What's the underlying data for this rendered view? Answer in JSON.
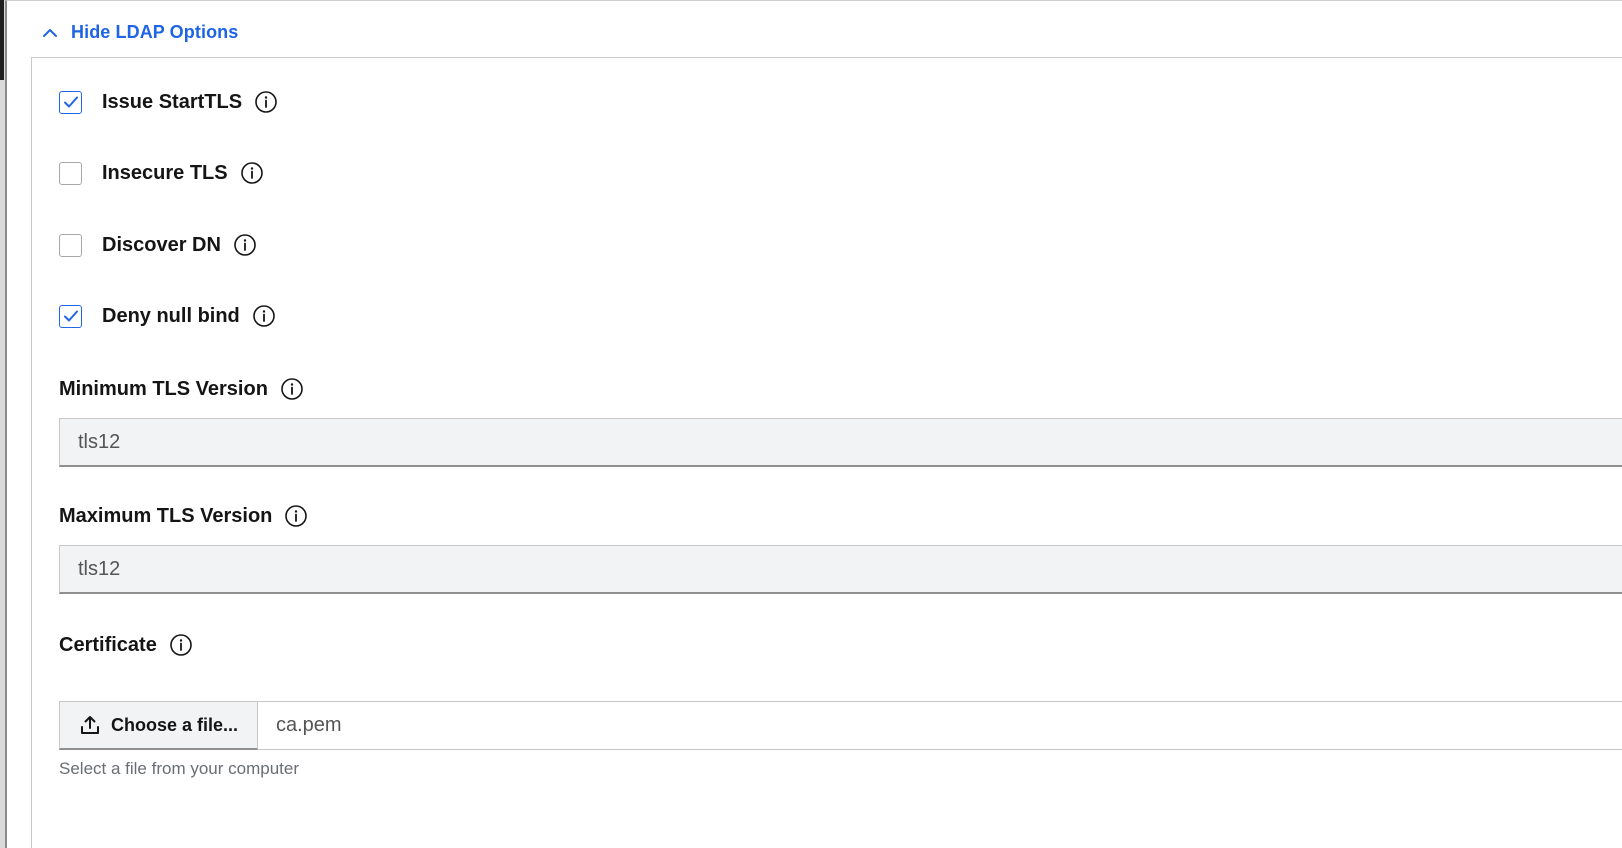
{
  "ldap_toggle": {
    "label": "Hide LDAP Options",
    "icon": "chevron-up-icon"
  },
  "options": [
    {
      "label": "Issue StartTLS",
      "checked": true
    },
    {
      "label": "Insecure TLS",
      "checked": false
    },
    {
      "label": "Discover DN",
      "checked": false
    },
    {
      "label": "Deny null bind",
      "checked": true
    }
  ],
  "min_tls": {
    "label": "Minimum TLS Version",
    "value": "tls12"
  },
  "max_tls": {
    "label": "Maximum TLS Version",
    "value": "tls12"
  },
  "certificate": {
    "label": "Certificate",
    "button_label": "Choose a file...",
    "file_name": "ca.pem",
    "helper_text": "Select a file from your computer"
  },
  "colors": {
    "accent": "#1f64e5",
    "checkbox_checked": "#2266e6",
    "text": "#151515",
    "muted": "#6a6e73"
  }
}
